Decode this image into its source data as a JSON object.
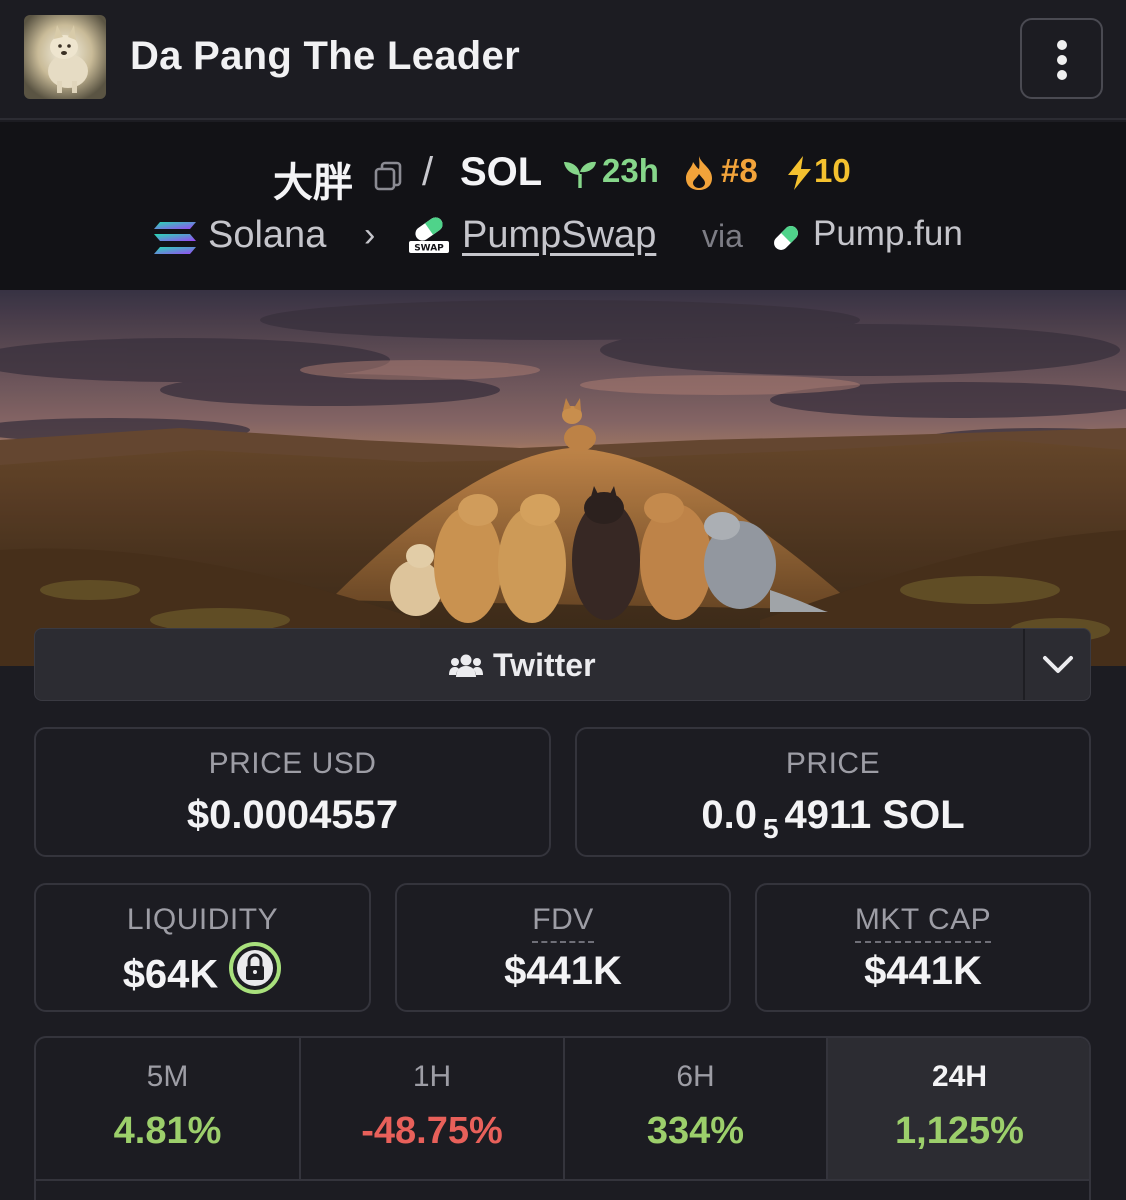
{
  "header": {
    "token_name": "Da Pang The Leader",
    "avatar_icon": "dog-avatar",
    "menu_icon": "more-vertical-icon"
  },
  "pair": {
    "base_symbol": "大胖",
    "separator": "/",
    "quote_symbol": "SOL",
    "age": "23h",
    "rank": "#8",
    "boosts": "10",
    "chain": "Solana",
    "chevron": "›",
    "dex": "PumpSwap",
    "via": "via",
    "launchpad": "Pump.fun",
    "colors": {
      "age": "#86d68a",
      "rank": "#f2a33a",
      "boosts": "#f4c12f"
    }
  },
  "social": {
    "label": "Twitter"
  },
  "stats": {
    "price_usd": {
      "label": "PRICE USD",
      "value": "$0.0004557"
    },
    "price_native": {
      "label": "PRICE",
      "prefix": "0.0",
      "zeros": "5",
      "digits": "4911",
      "unit": "SOL"
    },
    "liquidity": {
      "label": "LIQUIDITY",
      "value": "$64K"
    },
    "fdv": {
      "label": "FDV",
      "value": "$441K"
    },
    "mkt_cap": {
      "label": "MKT CAP",
      "value": "$441K"
    }
  },
  "changes": [
    {
      "label": "5M",
      "value": "4.81%",
      "sign": "pos"
    },
    {
      "label": "1H",
      "value": "-48.75%",
      "sign": "neg"
    },
    {
      "label": "6H",
      "value": "334%",
      "sign": "pos"
    },
    {
      "label": "24H",
      "value": "1,125%",
      "sign": "pos",
      "active": true
    }
  ],
  "colors": {
    "positive": "#9ccf6b",
    "negative": "#e8605a",
    "background": "#1c1c22"
  }
}
